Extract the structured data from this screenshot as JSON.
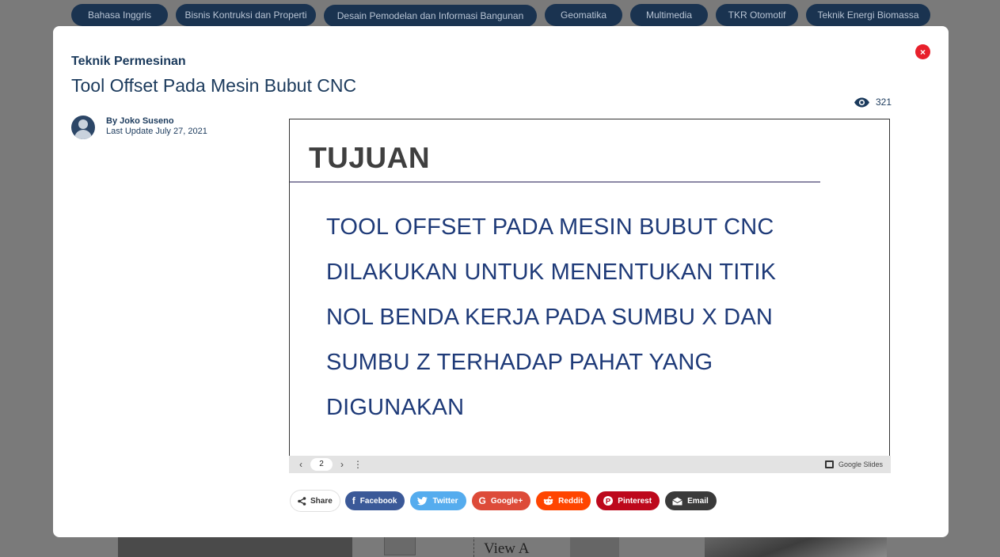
{
  "categories": [
    "Bahasa Inggris",
    "Bisnis Kontruksi dan Properti",
    "Desain Pemodelan dan Informasi Bangunan",
    "Geomatika",
    "Multimedia",
    "TKR Otomotif",
    "Teknik Energi Biomassa"
  ],
  "background": {
    "view_label": "View A"
  },
  "modal": {
    "close_glyph": "×",
    "category": "Teknik Permesinan",
    "title": "Tool Offset Pada Mesin Bubut CNC",
    "views": "321",
    "author_line": "By Joko Suseno",
    "last_update": "Last Update July 27, 2021"
  },
  "slide": {
    "heading": "TUJUAN",
    "lines": [
      "TOOL OFFSET PADA MESIN BUBUT CNC",
      "DILAKUKAN UNTUK MENENTUKAN TITIK",
      "NOL BENDA KERJA PADA SUMBU X DAN",
      "SUMBU Z TERHADAP PAHAT YANG",
      "DIGUNAKAN"
    ],
    "toolbar": {
      "prev_glyph": "‹",
      "page": "2",
      "next_glyph": "›",
      "menu_glyph": "⋮",
      "brand": "Google Slides"
    }
  },
  "share": {
    "label": "Share",
    "buttons": [
      {
        "key": "facebook",
        "label": "Facebook",
        "icon": "f",
        "color": "#3b5998"
      },
      {
        "key": "twitter",
        "label": "Twitter",
        "icon": "t",
        "color": "#55acee"
      },
      {
        "key": "googleplus",
        "label": "Google+",
        "icon": "G",
        "color": "#dd4b39"
      },
      {
        "key": "reddit",
        "label": "Reddit",
        "icon": "r",
        "color": "#ff4500"
      },
      {
        "key": "pinterest",
        "label": "Pinterest",
        "icon": "p",
        "color": "#bd081c"
      },
      {
        "key": "email",
        "label": "Email",
        "icon": "@",
        "color": "#3a3a3a"
      }
    ]
  }
}
